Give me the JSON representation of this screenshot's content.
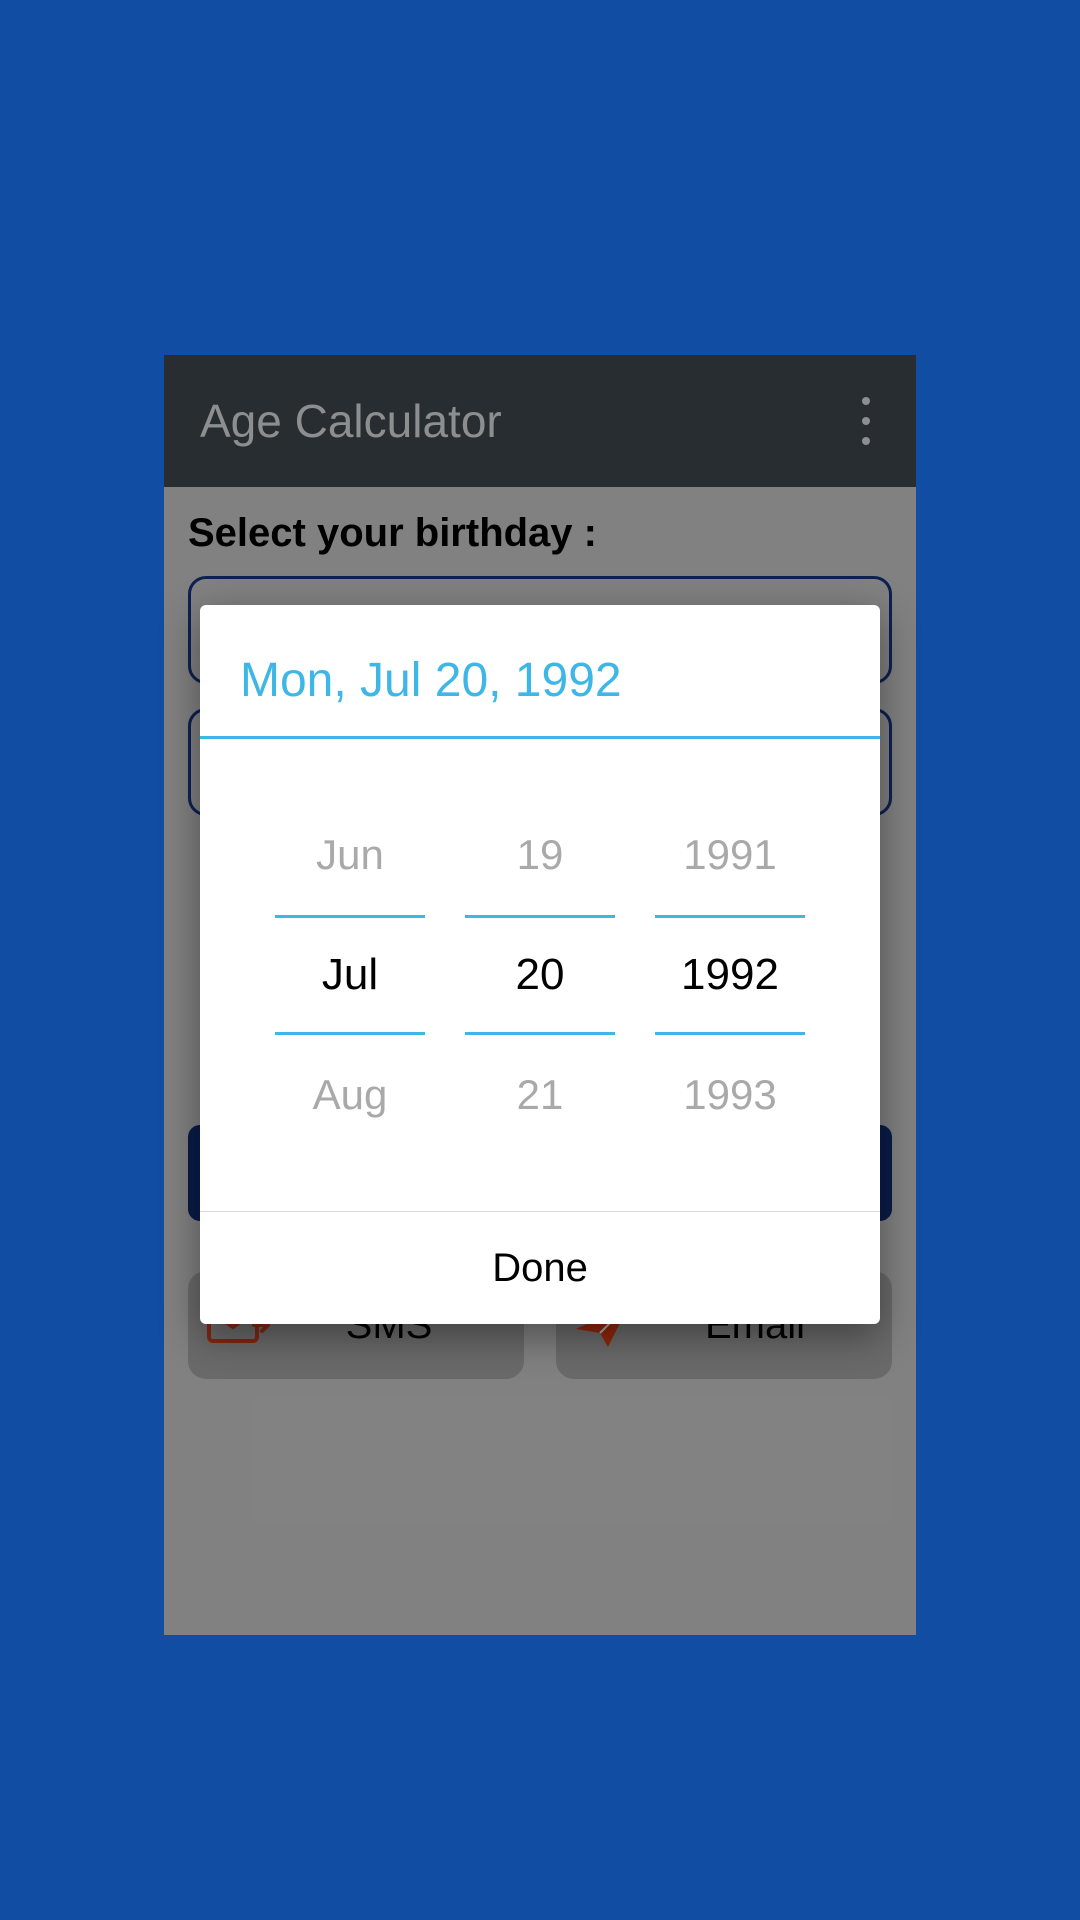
{
  "app": {
    "title": "Age Calculator"
  },
  "prompt": "Select your birthday :",
  "share": {
    "sms": "SMS",
    "email": "Email"
  },
  "dialog": {
    "header": "Mon, Jul 20, 1992",
    "month": {
      "prev": "Jun",
      "sel": "Jul",
      "next": "Aug"
    },
    "day": {
      "prev": "19",
      "sel": "20",
      "next": "21"
    },
    "year": {
      "prev": "1991",
      "sel": "1992",
      "next": "1993"
    },
    "done": "Done"
  }
}
